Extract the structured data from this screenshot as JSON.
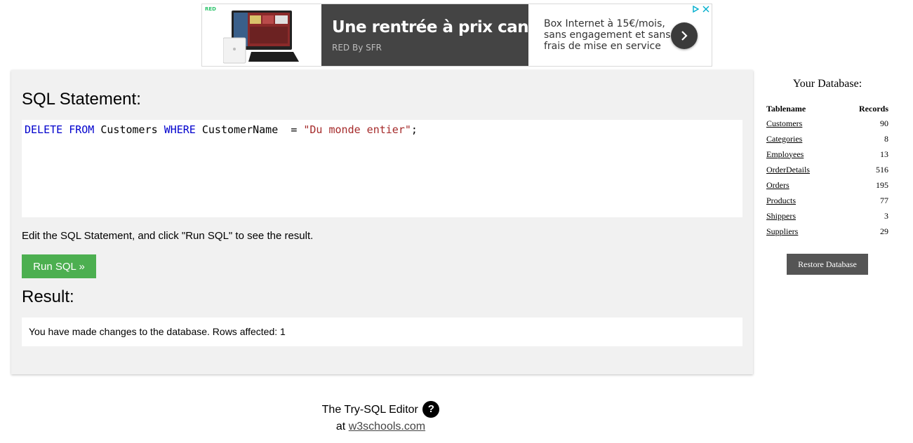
{
  "ad": {
    "brand_tag": "RED",
    "headline": "Une rentrée à prix canon",
    "sub": "RED By SFR",
    "description": "Box Internet à 15€/mois, sans engagement et sans frais de mise en service",
    "icons": [
      "adchoices-icon",
      "close-icon",
      "chevron-right-icon"
    ],
    "colors": {
      "dark_panel": "#444444",
      "tag": "#2cc36b"
    }
  },
  "editor_panel": {
    "sql_heading": "SQL Statement:",
    "code": {
      "kw_delete": "DELETE",
      "kw_from": "FROM",
      "table": "Customers",
      "kw_where": "WHERE",
      "column": "CustomerName",
      "operator": "=",
      "string": "\"Du monde entier\"",
      "terminator": ";"
    },
    "hint": "Edit the SQL Statement, and click \"Run SQL\" to see the result.",
    "run_button": "Run SQL »",
    "result_heading": "Result:",
    "result_text": "You have made changes to the database. Rows affected: 1",
    "colors": {
      "keyword": "#0000cd",
      "string": "#a52a2a",
      "run_button": "#4caf50",
      "panel": "#f1f1f1"
    }
  },
  "sidebar": {
    "title": "Your Database:",
    "col_name": "Tablename",
    "col_records": "Records",
    "tables": [
      {
        "name": "Customers",
        "records": "90"
      },
      {
        "name": "Categories",
        "records": "8"
      },
      {
        "name": "Employees",
        "records": "13"
      },
      {
        "name": "OrderDetails",
        "records": "516"
      },
      {
        "name": "Orders",
        "records": "195"
      },
      {
        "name": "Products",
        "records": "77"
      },
      {
        "name": "Shippers",
        "records": "3"
      },
      {
        "name": "Suppliers",
        "records": "29"
      }
    ],
    "restore_button": "Restore Database",
    "colors": {
      "restore_button": "#555555"
    }
  },
  "footer": {
    "line1": "The Try-SQL Editor",
    "help_glyph": "?",
    "at": "at",
    "link": "w3schools.com"
  }
}
